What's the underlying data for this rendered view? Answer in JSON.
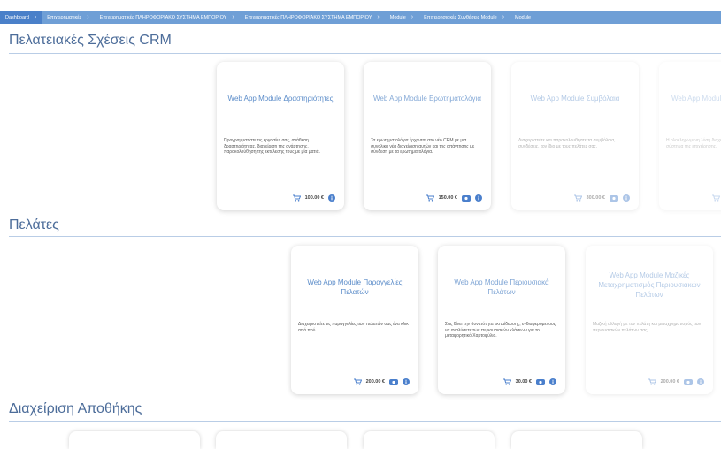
{
  "nav": {
    "items": [
      {
        "label": "Dashboard"
      },
      {
        "label": "Επιχειρηματικές"
      },
      {
        "label": "Επιχειρηματικές ΠΛΗΡΟΦΟΡΙΑΚΟ ΣΥΣΤΗΜΑ ΕΜΠΟΡΙΟΥ"
      },
      {
        "label": "Επιχειρηματικές ΠΛΗΡΟΦΟΡΙΑΚΟ ΣΥΣΤΗΜΑ ΕΜΠΟΡΙΟΥ"
      },
      {
        "label": "Module"
      },
      {
        "label": "Επιχειρησιακές Συνθέσεις Module"
      },
      {
        "label": "Module"
      }
    ]
  },
  "sections": {
    "crm": {
      "title": "Πελατειακές Σχέσεις CRM",
      "cards": [
        {
          "title": "Web App Module Δραστηριότητες",
          "desc": "Προγραμματίστε τις εργασίες σας, ανάθεση δραστηριότητας, διαχείριση της ανάρτησης, παρακολούθηση της εκτέλεσης τους με μία ματιά.",
          "price": "100.00 €"
        },
        {
          "title": "Web App Module Ερωτηματολόγια",
          "desc": "Τα ερωτηματολόγια έρχονται στο νέο CRM με μια συνολικά νέα διαχείριση αυτών και της απάντησης με σύνδεση με τα ερωτηματολόγια.",
          "price": "150.00 €"
        },
        {
          "title": "Web App Module Συμβόλαια",
          "desc": "Διαχειριστείτε και παρακολουθήστε τα συμβόλαια, συνδέσεις, τον ίδιο με τους πελάτες σας.",
          "price": "300.00 €"
        },
        {
          "title": "Web App Module Προσ",
          "desc": "Η ολοκληρωμένη λύση διαχείρισης προσφορών στο σύστημα της επιχείρησης.",
          "price": ""
        }
      ]
    },
    "customers": {
      "title": "Πελάτες",
      "cards": [
        {
          "title": "Web App Module Παραγγελίες Πελατών",
          "desc": "Διαχειριστείτε τις παραγγελίες των πελατών σας ένα κλικ από πού.",
          "price": "200.00 €"
        },
        {
          "title": "Web App Module Περιουσιακά Πελάτων",
          "desc": "Σας δίνει την δυνατότητα εκπαίδευσης, ενδιαφερόμενους να αναλύσετε των περιουσιακών κλάσεων για το μεταφορητικό Χαρτοφύλιο.",
          "price": "30.00 €"
        },
        {
          "title": "Web App Module Μαζικές Μεταχρηματισμός Περιουσιακών Πελάτων",
          "desc": "Μαζική αλλαγή με τον πελάτη και μεταχρηματισμός των περιουσιακών πελάτων σας.",
          "price": "200.00 €"
        }
      ]
    },
    "warehouse": {
      "title": "Διαχείριση Αποθήκης"
    }
  },
  "colors": {
    "nav_bg": "#6f9fd6",
    "nav_active": "#4a80c9",
    "accent": "#4a7fcc",
    "title_text": "#4d6d9a"
  },
  "icons": {
    "cart": "shopping-cart-icon",
    "eye": "eye-icon",
    "info": "info-icon"
  }
}
